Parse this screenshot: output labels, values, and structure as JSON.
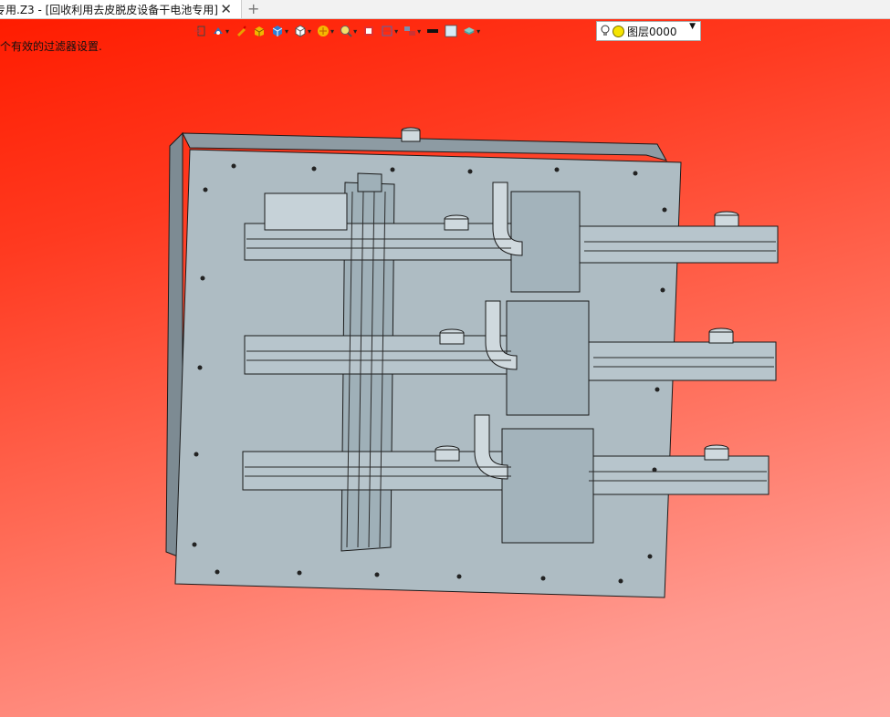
{
  "tab": {
    "title": "专用.Z3 - [回收利用去皮脱皮设备干电池专用]",
    "close": "✕",
    "new": "+"
  },
  "status_text": "个有效的过滤器设置.",
  "toolbar": {
    "icons": [
      "exit-sketch-icon",
      "view-style-icon",
      "pencil-icon",
      "box-yellow-icon",
      "cube-blue-icon",
      "cube-white-icon",
      "render-icon",
      "zoom-icon",
      "color-icon",
      "section-icon",
      "layout-icon",
      "line-black-icon",
      "fill-icon",
      "layer-stack-icon"
    ],
    "layer_name": "图层0000",
    "dropdown_glyph": "▾"
  },
  "colors": {
    "accent": "#ff2a10",
    "model_plate": "#aab8bf",
    "model_edge": "#1a1a1a"
  }
}
